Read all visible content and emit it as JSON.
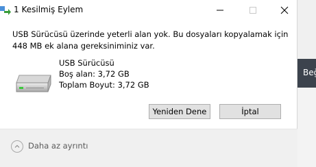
{
  "dialog": {
    "title": "1 Kesilmiş Eylem",
    "message": "USB Sürücüsü üzerinde yeterli alan yok. Bu dosyaları kopyalamak için 448 MB ek alana gereksiniminiz var.",
    "drive": {
      "name": "USB Sürücüsü",
      "free_space": "Boş alan: 3,72 GB",
      "total_size": "Toplam Boyut: 3,72 GB",
      "icon": "usb-drive-icon"
    },
    "buttons": {
      "retry": "Yeniden Dene",
      "cancel": "İptal"
    },
    "details_toggle": "Daha az ayrıntı"
  },
  "background_window": {
    "partial_text": "Beğ"
  },
  "colors": {
    "button_bg": "#e1e1e1",
    "footer_bg": "#f0f0f0",
    "background_dark": "#3c434d"
  }
}
